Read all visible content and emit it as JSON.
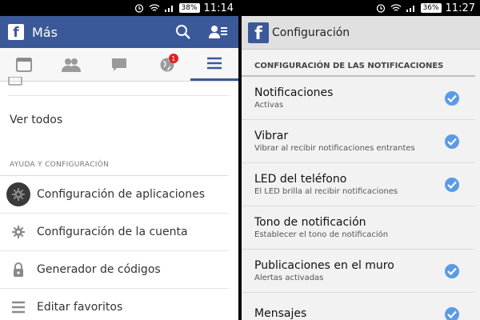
{
  "left": {
    "status": {
      "battery": "38%",
      "time": "11:14"
    },
    "header": {
      "title": "Más",
      "logo": "f"
    },
    "tabs": [
      {
        "icon": "news-feed-icon"
      },
      {
        "icon": "friends-icon"
      },
      {
        "icon": "messages-icon"
      },
      {
        "icon": "globe-notifications-icon",
        "badge": "1"
      },
      {
        "icon": "menu-icon"
      }
    ],
    "menu": {
      "see_all": "Ver todos",
      "section_title": "AYUDA Y CONFIGURACIÓN",
      "items": [
        {
          "label": "Configuración de aplicaciones",
          "icon": "gear-icon"
        },
        {
          "label": "Configuración de la cuenta",
          "icon": "gear-icon"
        },
        {
          "label": "Generador de códigos",
          "icon": "lock-icon"
        },
        {
          "label": "Editar favoritos",
          "icon": "list-icon"
        }
      ]
    }
  },
  "right": {
    "status": {
      "battery": "36%",
      "time": "11:27"
    },
    "action_bar": {
      "title": "Configuración",
      "logo": "f"
    },
    "category": "CONFIGURACIÓN DE LAS NOTIFICACIONES",
    "prefs": [
      {
        "title": "Notificaciones",
        "summary": "Activas",
        "checked": true
      },
      {
        "title": "Vibrar",
        "summary": "Vibrar al recibir notificaciones entrantes",
        "checked": true
      },
      {
        "title": "LED del teléfono",
        "summary": "El LED brilla al recibir notificaciones",
        "checked": true
      },
      {
        "title": "Tono de notificación",
        "summary": "Establecer el tono de notificación",
        "checked": false
      },
      {
        "title": "Publicaciones en el muro",
        "summary": "Alertas activadas",
        "checked": true
      },
      {
        "title": "Mensajes",
        "summary": "",
        "checked": true
      }
    ]
  }
}
